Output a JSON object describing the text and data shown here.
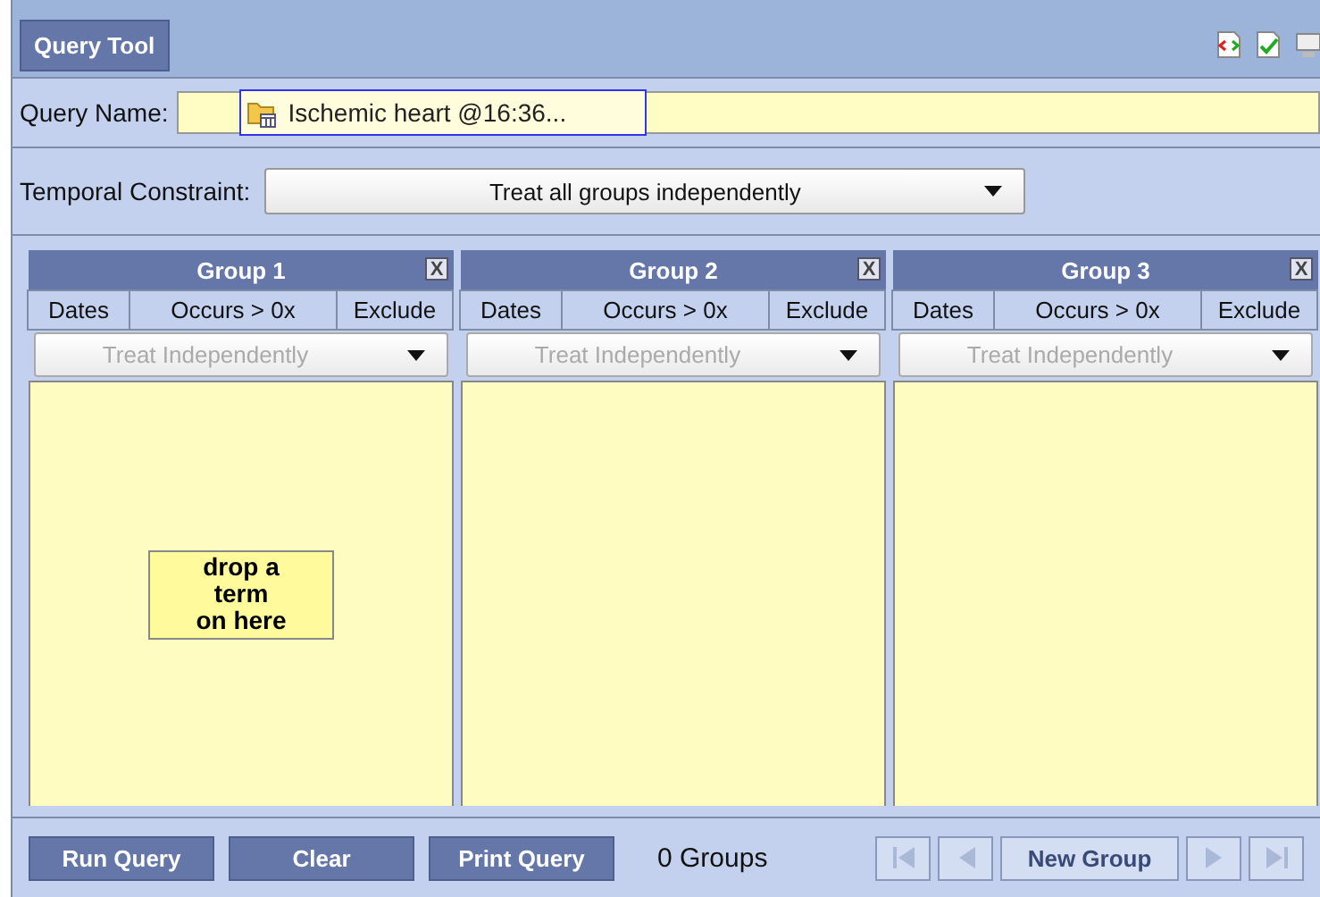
{
  "tab": {
    "label": "Query Tool",
    "selected": true
  },
  "query_name": {
    "label": "Query Name:",
    "value": "Ischemic heart @16:36..."
  },
  "temporal_constraint": {
    "label": "Temporal Constraint:",
    "value": "Treat all groups independently"
  },
  "groups": [
    {
      "title": "Group 1",
      "close": "X",
      "columns": [
        "Dates",
        "Occurs > 0x",
        "Exclude"
      ],
      "timing": "Treat Independently",
      "drop_hint": "drop a\nterm\non here"
    },
    {
      "title": "Group 2",
      "close": "X",
      "columns": [
        "Dates",
        "Occurs > 0x",
        "Exclude"
      ],
      "timing": "Treat Independently"
    },
    {
      "title": "Group 3",
      "close": "X",
      "columns": [
        "Dates",
        "Occurs > 0x",
        "Exclude"
      ],
      "timing": "Treat Independently"
    }
  ],
  "footer": {
    "buttons": [
      "Run Query",
      "Clear",
      "Print Query"
    ],
    "count": "0 Groups",
    "nav": [
      {
        "kind": "first",
        "disabled": true
      },
      {
        "kind": "prev",
        "disabled": true
      },
      {
        "kind": "label",
        "label": "New Group",
        "disabled": false
      },
      {
        "kind": "next",
        "disabled": true
      },
      {
        "kind": "last",
        "disabled": true
      }
    ]
  }
}
